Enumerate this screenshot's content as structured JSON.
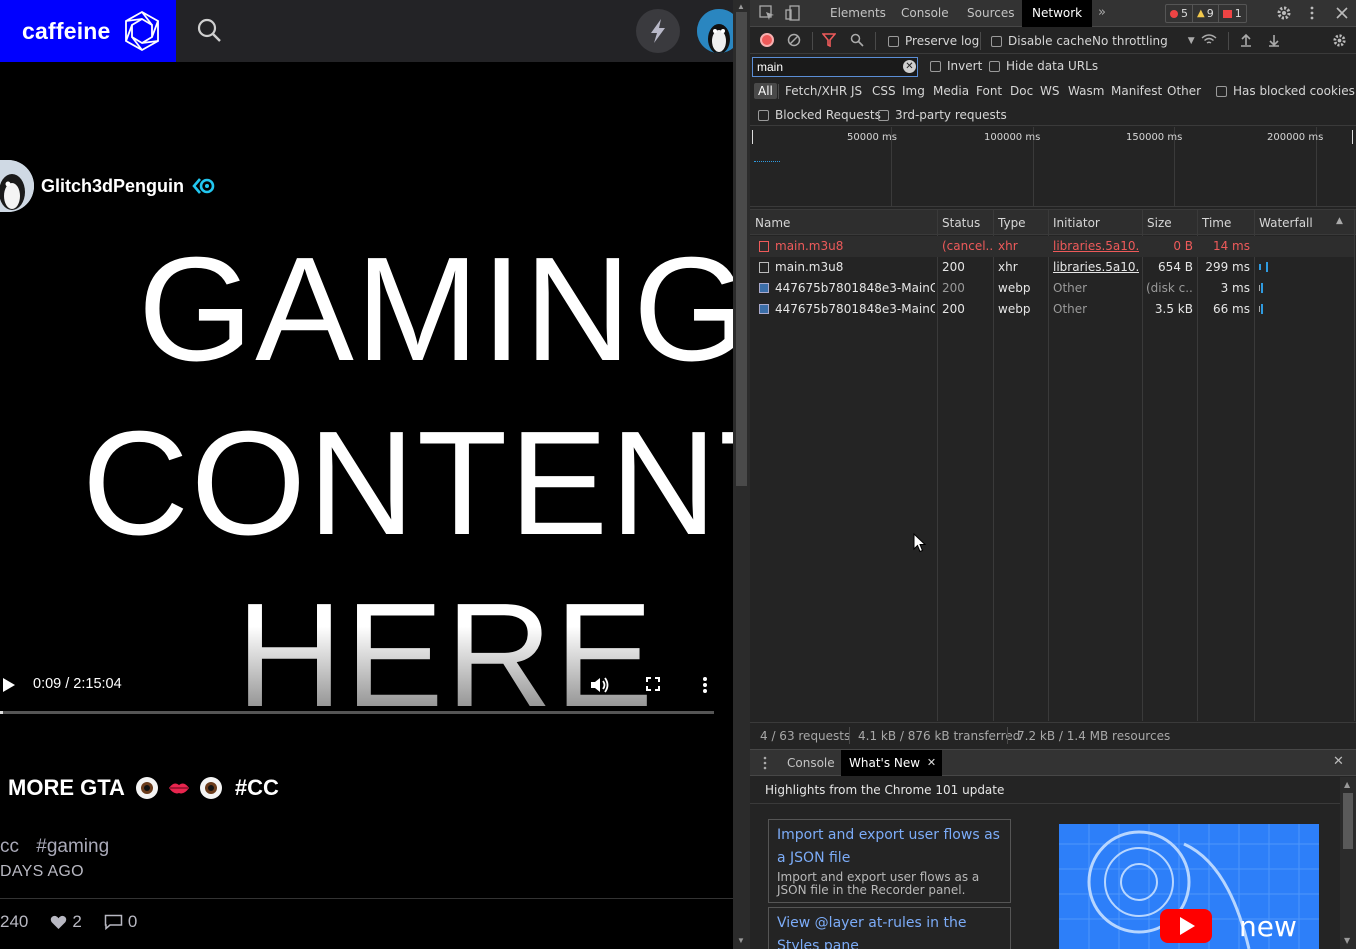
{
  "app": {
    "brand": "caffeine",
    "username": "Glitch3dPenguin",
    "video": {
      "text_lines": [
        "GAMING",
        "CONTENT",
        "HERE"
      ],
      "time_display": "0:09 / 2:15:04",
      "progress_fraction": 0.0011
    },
    "post": {
      "title": "MORE GTA",
      "title_tag": "#CC",
      "tags": [
        "cc",
        "#gaming"
      ],
      "posted": "DAYS AGO",
      "views": "240",
      "likes": "2",
      "comments": "0"
    },
    "colors": {
      "brand_blue": "#0000ff",
      "verified_cyan": "#22c7f0"
    }
  },
  "devtools": {
    "tabs": [
      "Elements",
      "Console",
      "Sources",
      "Network"
    ],
    "active_tab": "Network",
    "badges": {
      "errors": "5",
      "warnings": "9",
      "issues": "1"
    },
    "toolbar": {
      "preserve_log": "Preserve log",
      "disable_cache": "Disable cache",
      "throttling": "No throttling"
    },
    "filter": {
      "value": "main",
      "invert": "Invert",
      "hide_data_urls": "Hide data URLs"
    },
    "types": [
      "All",
      "Fetch/XHR",
      "JS",
      "CSS",
      "Img",
      "Media",
      "Font",
      "Doc",
      "WS",
      "Wasm",
      "Manifest",
      "Other"
    ],
    "has_blocked_cookies": "Has blocked cookies",
    "blocked_requests": "Blocked Requests",
    "third_party": "3rd-party requests",
    "overview_ticks": [
      "50000 ms",
      "100000 ms",
      "150000 ms",
      "200000 ms"
    ],
    "columns": [
      "Name",
      "Status",
      "Type",
      "Initiator",
      "Size",
      "Time",
      "Waterfall"
    ],
    "rows": [
      {
        "name": "main.m3u8",
        "status": "(cancel...",
        "type": "xhr",
        "initiator": "libraries.5a10...",
        "size": "0 B",
        "time": "14 ms",
        "failed": true
      },
      {
        "name": "main.m3u8",
        "status": "200",
        "type": "xhr",
        "initiator": "libraries.5a10...",
        "size": "654 B",
        "time": "299 ms",
        "failed": false
      },
      {
        "name": "447675b7801848e3-MainC...",
        "status": "200",
        "type": "webp",
        "initiator": "Other",
        "size": "(disk c...",
        "time": "3 ms",
        "failed": false
      },
      {
        "name": "447675b7801848e3-MainC...",
        "status": "200",
        "type": "webp",
        "initiator": "Other",
        "size": "3.5 kB",
        "time": "66 ms",
        "failed": false
      }
    ],
    "status_bar": {
      "requests": "4 / 63 requests",
      "transferred": "4.1 kB / 876 kB transferred",
      "resources": "7.2 kB / 1.4 MB resources"
    },
    "drawer": {
      "tabs": [
        "Console",
        "What's New"
      ],
      "active": "What's New",
      "heading": "Highlights from the Chrome 101 update",
      "cards": [
        {
          "title": "Import and export user flows as a JSON file",
          "desc": "Import and export user flows as a JSON file in the Recorder panel."
        },
        {
          "title": "View @layer at-rules in the Styles pane",
          "desc": ""
        }
      ],
      "promo_text": "new"
    }
  }
}
